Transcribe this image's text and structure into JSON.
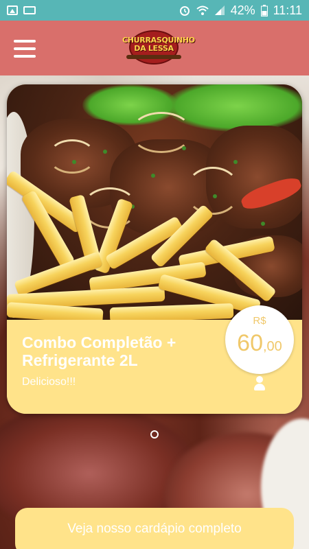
{
  "status_bar": {
    "battery_percent": "42%",
    "time": "11:11",
    "left_icons": [
      "image-icon",
      "voicemail-icon"
    ],
    "right_icons": [
      "alarm-icon",
      "wifi-icon",
      "signal-icon",
      "battery-icon"
    ]
  },
  "header": {
    "logo_text": "CHURRASQUINHO DA LESSA",
    "menu_icon": "hamburger-menu-icon"
  },
  "featured_item": {
    "title": "Combo Completão + Refrigerante 2L",
    "description": "Delicioso!!!",
    "price_currency": "R$",
    "price_integer": "60",
    "price_cents": ",00",
    "icon": "user-icon"
  },
  "carousel": {
    "current_page": 1
  },
  "cta": {
    "label": "Veja nosso cardápio completo"
  },
  "colors": {
    "status_bar": "#57b6b6",
    "header": "#d96f6b",
    "card_accent": "#ffe38a",
    "price_text": "#f0c86a"
  }
}
